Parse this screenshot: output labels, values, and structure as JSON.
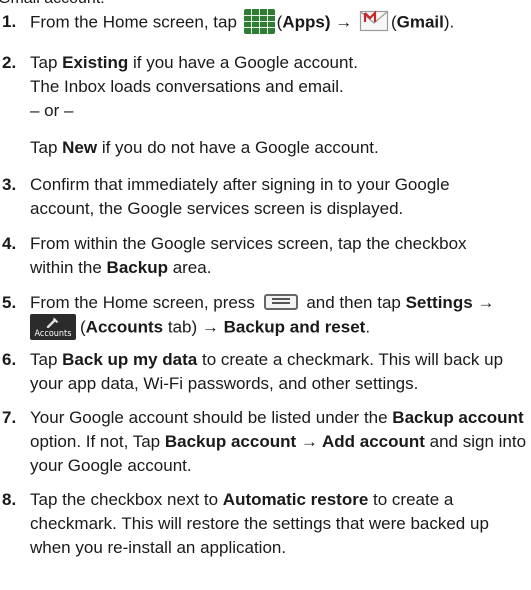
{
  "intro": {
    "text": "Gmail account:"
  },
  "steps": [
    {
      "num": "1.",
      "parts": [
        "From the Home screen, tap",
        "(",
        "Apps",
        ") →",
        "(",
        "Gmail",
        ")."
      ]
    },
    {
      "num": "2.",
      "lines": [
        [
          "Tap ",
          "Existing",
          " if you have a Google account."
        ],
        [
          "The Inbox loads conversations and email."
        ],
        [
          "– or –"
        ]
      ],
      "alt": [
        "Tap ",
        "New",
        " if you do not have a Google account."
      ]
    },
    {
      "num": "3.",
      "lines": [
        [
          "Confirm that immediately after signing in to your Google"
        ],
        [
          "account, the Google services screen is displayed."
        ]
      ]
    },
    {
      "num": "4.",
      "lines": [
        [
          "From within the Google services screen, tap the checkbox"
        ],
        [
          "within the ",
          "Backup",
          " area."
        ]
      ]
    },
    {
      "num": "5.",
      "parts": [
        "From the Home screen, press",
        "and then tap",
        "Settings →"
      ],
      "parts2": [
        "(",
        "Accounts",
        " tab) ",
        "→",
        " Backup and reset",
        "."
      ]
    },
    {
      "num": "6.",
      "lines": [
        [
          "Tap ",
          "Back up my data",
          " to create a checkmark. This will back up"
        ],
        [
          "your app data, Wi-Fi passwords, and other settings."
        ]
      ]
    },
    {
      "num": "7.",
      "lines": [
        [
          "Your Google account should be listed under the ",
          "Backup account"
        ],
        [
          "option. If not, Tap ",
          "Backup account → Add account",
          " and sign into"
        ],
        [
          "your Google account."
        ]
      ]
    },
    {
      "num": "8.",
      "lines": [
        [
          "Tap the checkbox next to ",
          "Automatic restore",
          " to create a"
        ],
        [
          "checkmark. This will restore the settings that were backed up"
        ],
        [
          "when you re-install an application."
        ]
      ]
    }
  ],
  "icons": {
    "accounts_label": "Accounts",
    "apps_icon": "apps-grid-icon",
    "gmail_icon": "gmail-envelope-icon",
    "menu_icon": "menu-key-icon",
    "accounts_icon": "accounts-tab-icon"
  }
}
